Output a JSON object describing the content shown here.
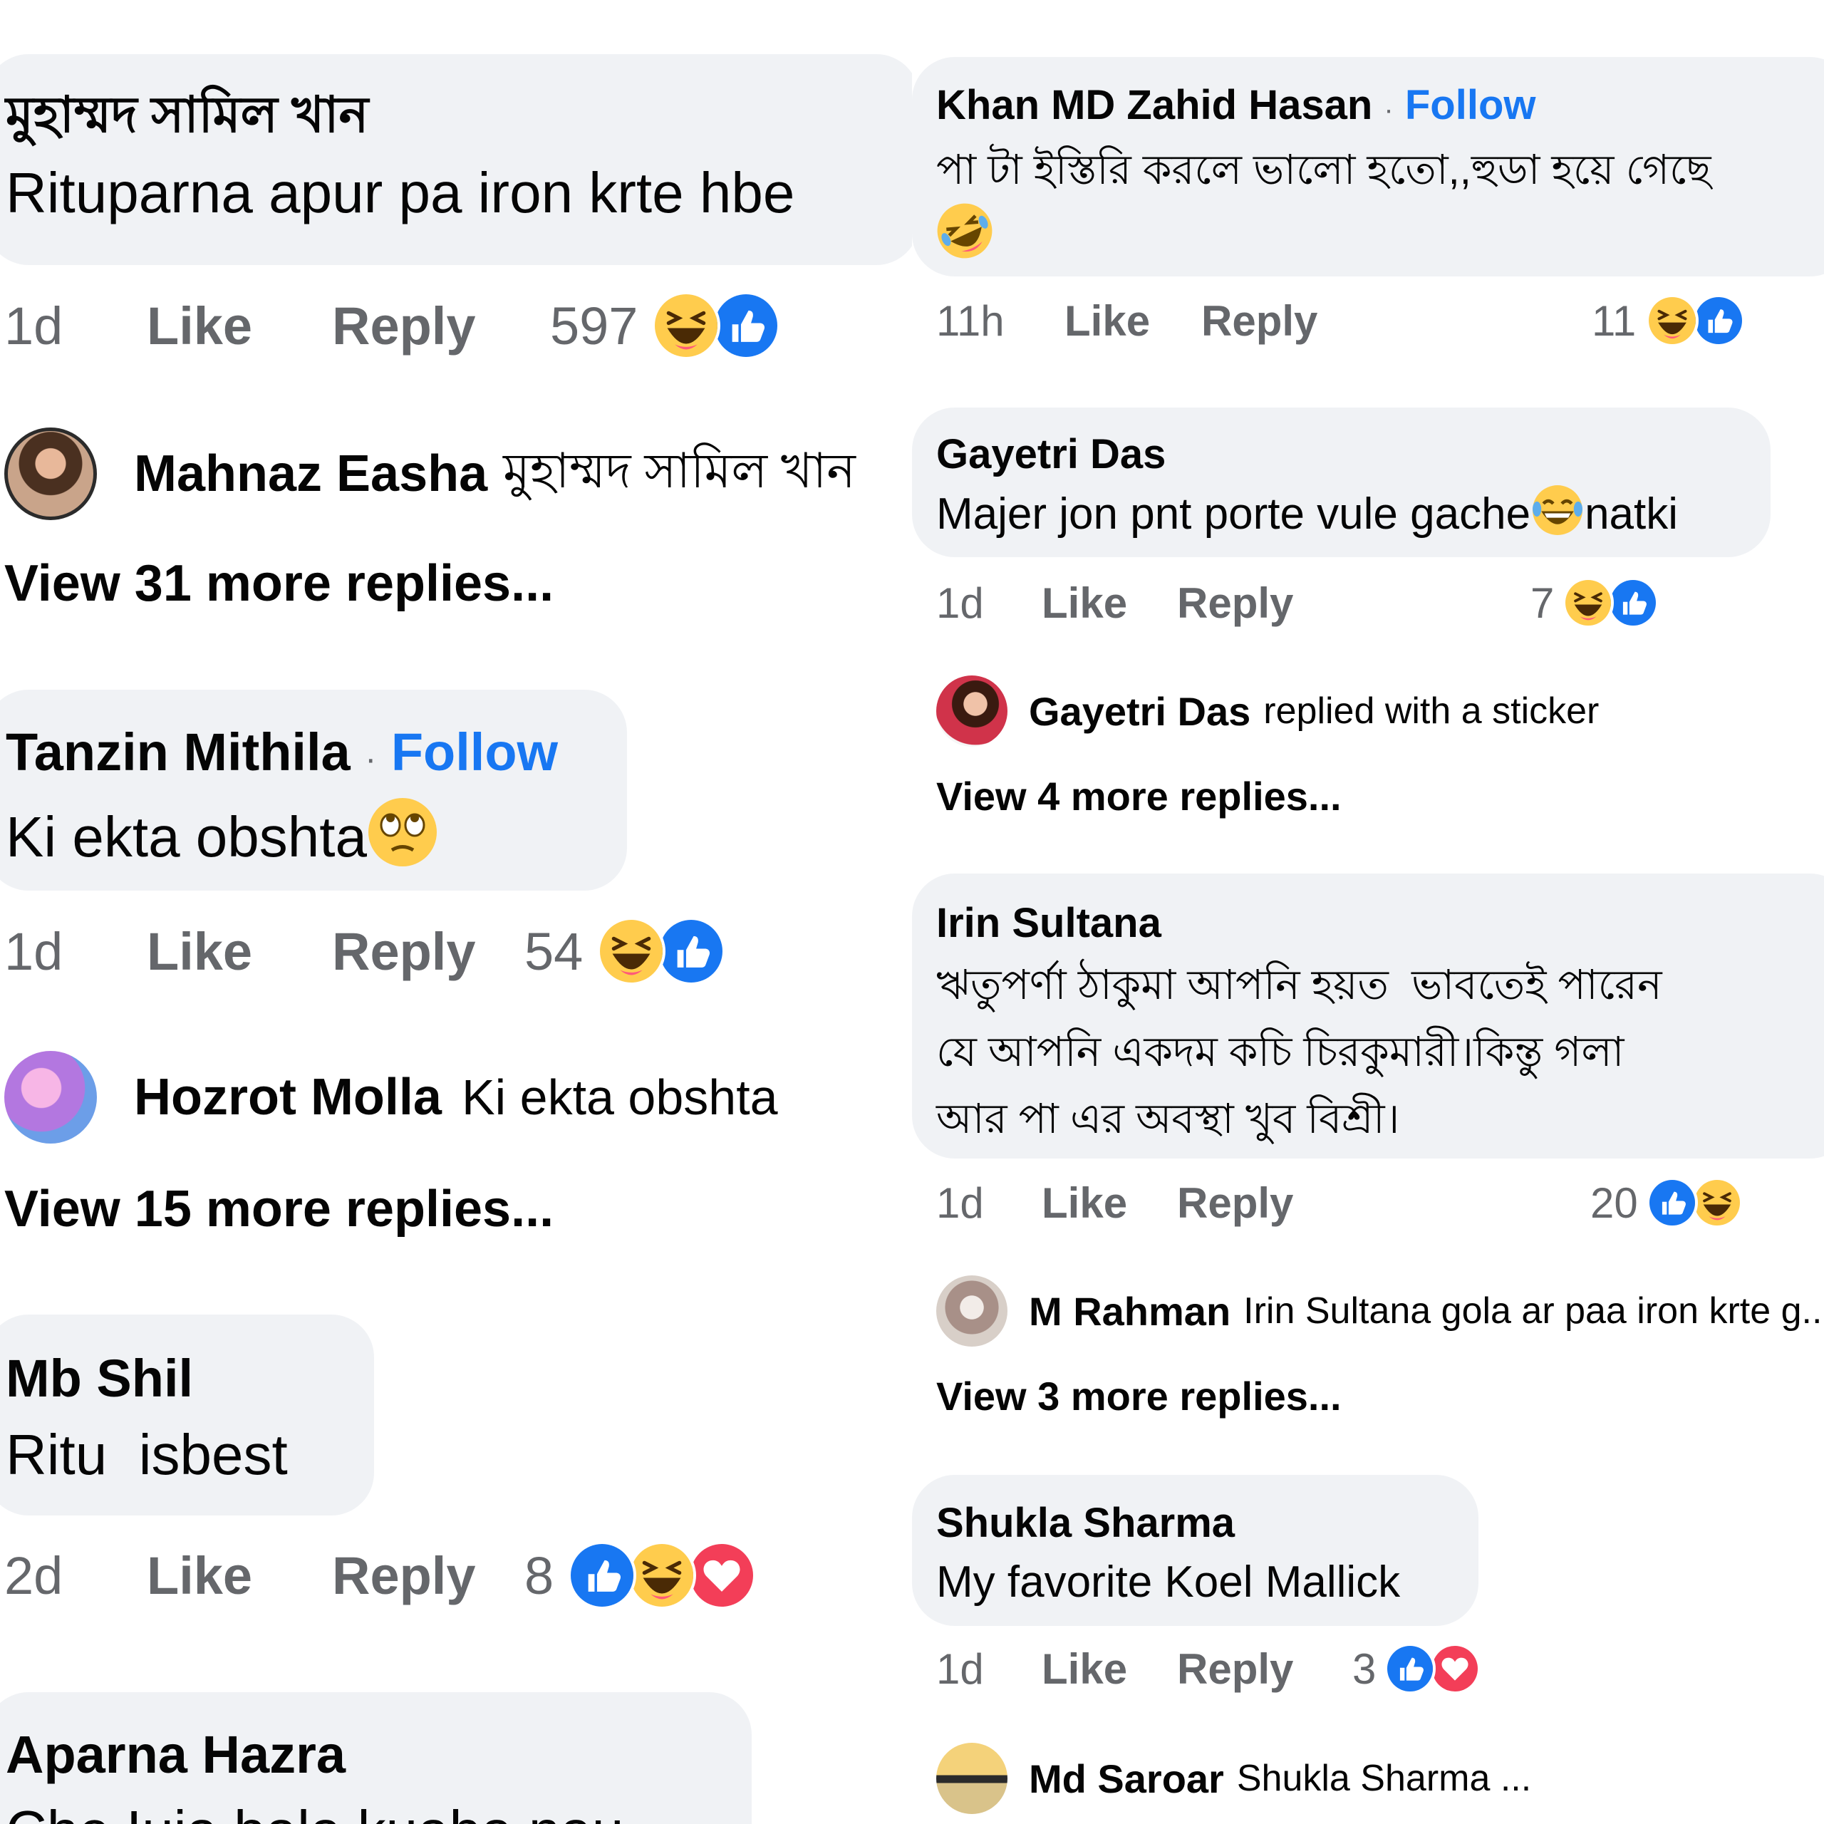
{
  "left": {
    "c1": {
      "author": "মুহাম্মদ সামিল খান",
      "text": "Rituparna apur pa iron krte hbe",
      "time": "1d",
      "like": "Like",
      "reply": "Reply",
      "count": "597",
      "reactions": [
        "haha-icon",
        "like-icon"
      ]
    },
    "c1_reply": {
      "author": "Mahnaz Easha",
      "text": "মুহাম্মদ সামিল খান"
    },
    "c1_more": "View 31 more replies...",
    "c2": {
      "author": "Tanzin Mithila",
      "separator": "·",
      "follow": "Follow",
      "text": "Ki ekta obshta",
      "time": "1d",
      "like": "Like",
      "reply": "Reply",
      "count": "54",
      "reactions": [
        "haha-icon",
        "like-icon"
      ]
    },
    "c2_reply": {
      "author": "Hozrot Molla",
      "text": "Ki ekta obshta"
    },
    "c2_more": "View 15 more replies...",
    "c3": {
      "author": "Mb Shil",
      "text": "Ritu  isbest",
      "time": "2d",
      "like": "Like",
      "reply": "Reply",
      "count": "8",
      "reactions": [
        "like-icon",
        "haha-icon",
        "love-icon"
      ]
    },
    "c4": {
      "author": "Aparna Hazra",
      "text": "Che Iuia bala kuaba nau"
    }
  },
  "right": {
    "c1": {
      "author": "Khan MD Zahid Hasan",
      "separator": "·",
      "follow": "Follow",
      "text": "পা টা ইস্তিরি করলে ভালো হতো,,হুডা হয়ে গেছে",
      "time": "11h",
      "like": "Like",
      "reply": "Reply",
      "count": "11",
      "reactions": [
        "haha-icon",
        "like-icon"
      ]
    },
    "c2": {
      "author": "Gayetri Das",
      "text": "Majer jon pnt porte vule gache",
      "text_tail": "natki",
      "time": "1d",
      "like": "Like",
      "reply": "Reply",
      "count": "7",
      "reactions": [
        "haha-icon",
        "like-icon"
      ]
    },
    "c2_reply": {
      "author": "Gayetri Das",
      "text": "replied with a sticker"
    },
    "c2_more": "View 4 more replies...",
    "c3": {
      "author": "Irin Sultana",
      "lines": [
        "ঋতুপর্ণা ঠাকুমা আপনি হয়ত  ভাবতেই পারেন",
        "যে আপনি একদম কচি চিরকুমারী।কিন্তু গলা",
        "আর পা এর অবস্থা খুব বিশ্রী।"
      ],
      "time": "1d",
      "like": "Like",
      "reply": "Reply",
      "count": "20",
      "reactions": [
        "like-icon",
        "haha-icon"
      ]
    },
    "c3_reply": {
      "author": "M Rahman",
      "text": "Irin Sultana gola ar paa iron krte g..."
    },
    "c3_more": "View 3 more replies...",
    "c4": {
      "author": "Shukla Sharma",
      "text": "My favorite Koel Mallick",
      "time": "1d",
      "like": "Like",
      "reply": "Reply",
      "count": "3",
      "reactions": [
        "like-icon",
        "love-icon"
      ]
    },
    "c4_reply": {
      "author": "Md Saroar",
      "text": "Shukla Sharma ..."
    }
  },
  "colors": {
    "bubble": "#f0f2f5",
    "meta": "#65676b",
    "link": "#1877f2",
    "text": "#050505"
  }
}
